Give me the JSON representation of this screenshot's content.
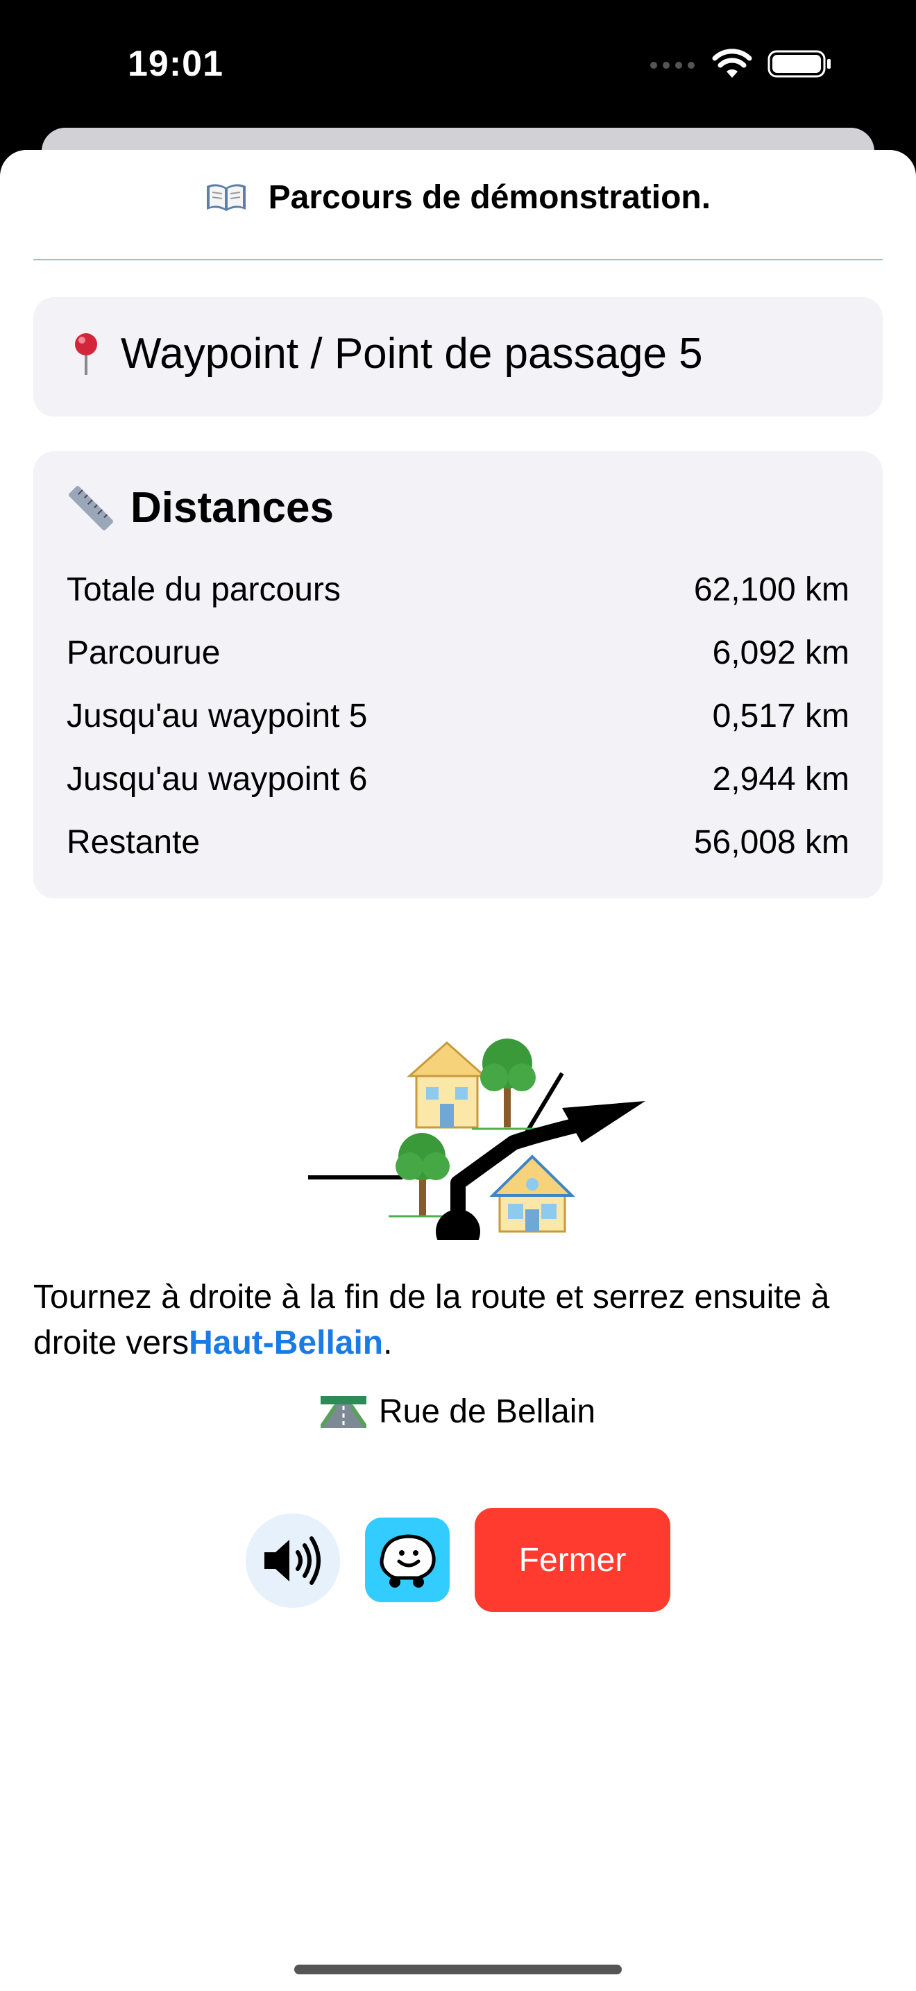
{
  "status_bar": {
    "time": "19:01"
  },
  "sheet": {
    "title": "Parcours de démonstration.",
    "title_icon": "open-book-icon"
  },
  "waypoint": {
    "icon": "pushpin-icon",
    "label": "Waypoint / Point de passage 5"
  },
  "distances": {
    "icon": "ruler-icon",
    "title": "Distances",
    "rows": [
      {
        "label": "Totale du parcours",
        "value": "62,100 km"
      },
      {
        "label": "Parcourue",
        "value": "6,092 km"
      },
      {
        "label": "Jusqu'au waypoint 5",
        "value": "0,517 km"
      },
      {
        "label": "Jusqu'au waypoint 6",
        "value": "2,944 km"
      },
      {
        "label": "Restante",
        "value": "56,008 km"
      }
    ]
  },
  "maneuver": {
    "icon": "turn-right-then-keep-right-icon"
  },
  "instruction": {
    "text_before": "Tournez à droite à la fin de la route et serrez ensuite à droite vers",
    "destination": "Haut-Bellain",
    "text_after": "."
  },
  "street": {
    "icon": "motorway-icon",
    "name": "Rue de Bellain"
  },
  "actions": {
    "sound_icon": "speaker-icon",
    "waze_icon": "waze-icon",
    "close_label": "Fermer"
  },
  "colors": {
    "link": "#1a7ae6",
    "close_button": "#ff3b30",
    "waze": "#33ccff",
    "card": "#f2f2f7"
  }
}
